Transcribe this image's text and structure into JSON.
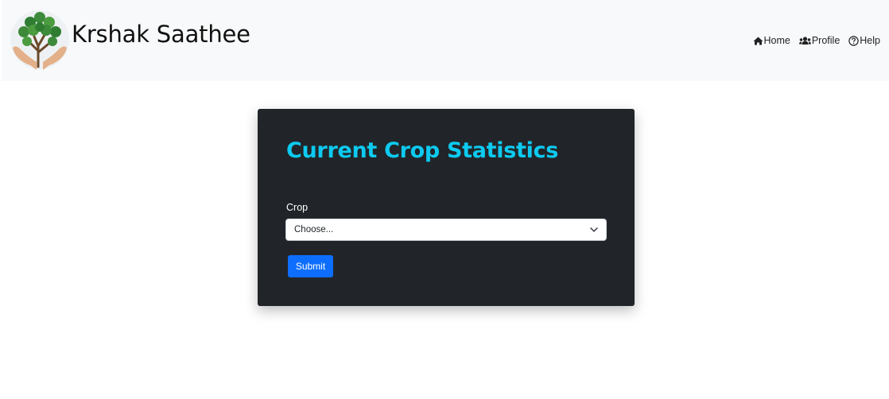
{
  "navbar": {
    "brand_name": "Krshak Saathee",
    "logo_icon": "tree-in-hands-logo",
    "links": [
      {
        "label": "Home",
        "icon": "home-icon"
      },
      {
        "label": "Profile",
        "icon": "users-icon"
      },
      {
        "label": "Help",
        "icon": "help-circle-icon"
      }
    ]
  },
  "card": {
    "title": "Current Crop Statistics",
    "crop_label": "Crop",
    "crop_select_value": "Choose...",
    "submit_label": "Submit"
  },
  "colors": {
    "navbar_bg": "#f8f9fa",
    "card_bg": "#212529",
    "title_color": "#0dcaf0",
    "button_bg": "#0d6efd"
  }
}
